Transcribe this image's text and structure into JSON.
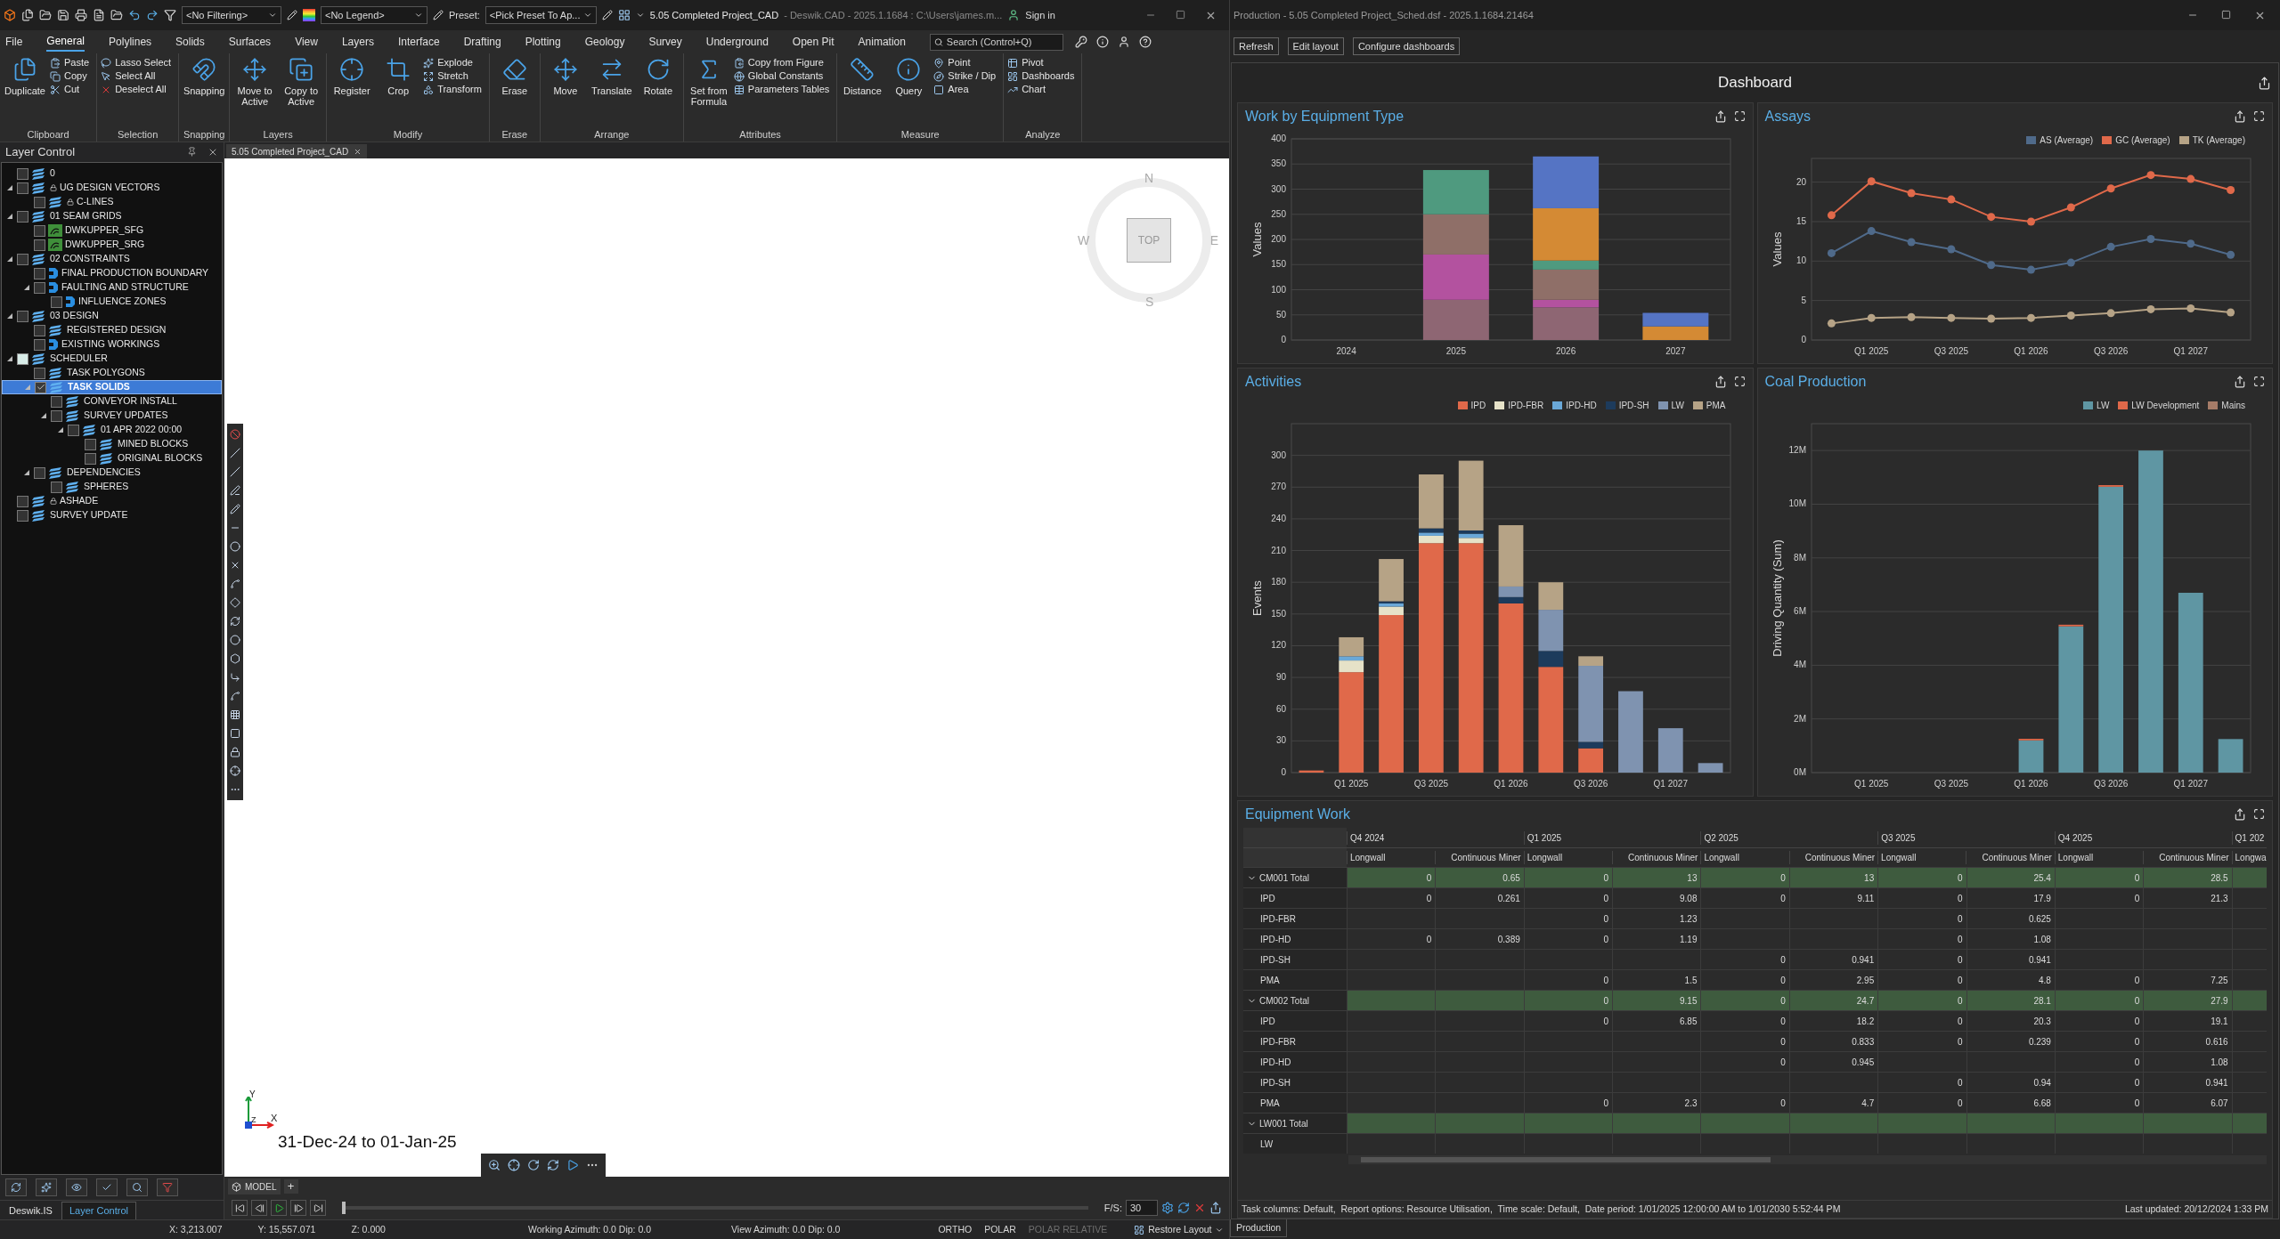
{
  "cad": {
    "title": "5.05 Completed Project_CAD",
    "title_detail": "- Deswik.CAD - 2025.1.1684 : C:\\Users\\james.m...",
    "filter": "<No Filtering>",
    "legend": "<No Legend>",
    "preset_label": "Preset:",
    "preset": "<Pick Preset To Ap...",
    "sign_in": "Sign in",
    "tabs": [
      {
        "label": "File",
        "selected": false
      },
      {
        "label": "General",
        "selected": true
      },
      {
        "label": "Polylines",
        "selected": false
      },
      {
        "label": "Solids",
        "selected": false
      },
      {
        "label": "Surfaces",
        "selected": false
      },
      {
        "label": "View",
        "selected": false
      },
      {
        "label": "Layers",
        "selected": false
      },
      {
        "label": "Interface",
        "selected": false
      },
      {
        "label": "Drafting",
        "selected": false
      },
      {
        "label": "Plotting",
        "selected": false
      },
      {
        "label": "Geology",
        "selected": false
      },
      {
        "label": "Survey",
        "selected": false
      },
      {
        "label": "Underground",
        "selected": false
      },
      {
        "label": "Open Pit",
        "selected": false
      },
      {
        "label": "Animation",
        "selected": false
      }
    ],
    "search": {
      "placeholder": "Search (Control+Q)"
    },
    "ribbon": [
      {
        "label": "Clipboard",
        "items": [
          {
            "label": "Duplicate",
            "kind": "large"
          },
          {
            "label": "Paste",
            "kind": "small"
          },
          {
            "label": "Copy",
            "kind": "small"
          },
          {
            "label": "Cut",
            "kind": "small"
          }
        ]
      },
      {
        "label": "Selection",
        "items": [
          {
            "label": "Lasso Select",
            "kind": "small"
          },
          {
            "label": "Select All",
            "kind": "small"
          },
          {
            "label": "Deselect All",
            "kind": "small"
          }
        ]
      },
      {
        "label": "Snapping",
        "items": [
          {
            "label": "Snapping",
            "kind": "large"
          }
        ]
      },
      {
        "label": "Layers",
        "items": [
          {
            "label": "Move to Active",
            "kind": "large"
          },
          {
            "label": "Copy to Active",
            "kind": "large"
          }
        ]
      },
      {
        "label": "Modify",
        "items": [
          {
            "label": "Register",
            "kind": "large"
          },
          {
            "label": "Crop",
            "kind": "large"
          },
          {
            "label": "Explode",
            "kind": "small"
          },
          {
            "label": "Stretch",
            "kind": "small"
          },
          {
            "label": "Transform",
            "kind": "small"
          }
        ]
      },
      {
        "label": "Erase",
        "items": [
          {
            "label": "Erase",
            "kind": "large"
          }
        ]
      },
      {
        "label": "Arrange",
        "items": [
          {
            "label": "Move",
            "kind": "large"
          },
          {
            "label": "Translate",
            "kind": "large"
          },
          {
            "label": "Rotate",
            "kind": "large"
          }
        ]
      },
      {
        "label": "Attributes",
        "items": [
          {
            "label": "Set from Formula",
            "kind": "large"
          },
          {
            "label": "Copy from Figure",
            "kind": "small"
          },
          {
            "label": "Global Constants",
            "kind": "small"
          },
          {
            "label": "Parameters Tables",
            "kind": "small"
          }
        ]
      },
      {
        "label": "Measure",
        "items": [
          {
            "label": "Distance",
            "kind": "large"
          },
          {
            "label": "Query",
            "kind": "large"
          },
          {
            "label": "Point",
            "kind": "small"
          },
          {
            "label": "Strike / Dip",
            "kind": "small"
          },
          {
            "label": "Area",
            "kind": "small"
          }
        ]
      },
      {
        "label": "Analyze",
        "items": [
          {
            "label": "Pivot",
            "kind": "small"
          },
          {
            "label": "Dashboards",
            "kind": "small"
          },
          {
            "label": "Chart",
            "kind": "small"
          }
        ]
      }
    ],
    "layer_panel": {
      "title": "Layer Control",
      "layers": [
        {
          "label": "0",
          "checked": false,
          "locked": false,
          "kind": "layers",
          "selected": false
        },
        {
          "label": "UG DESIGN VECTORS",
          "checked": false,
          "locked": true,
          "kind": "layers",
          "selected": false,
          "children": [
            {
              "label": "C-LINES",
              "checked": false,
              "locked": true,
              "kind": "layers",
              "selected": false
            }
          ]
        },
        {
          "label": "01 SEAM GRIDS",
          "checked": false,
          "locked": false,
          "kind": "layers",
          "selected": false,
          "children": [
            {
              "label": "DWKUPPER_SFG",
              "checked": false,
              "locked": false,
              "kind": "grid",
              "selected": false
            },
            {
              "label": "DWKUPPER_SRG",
              "checked": false,
              "locked": false,
              "kind": "grid",
              "selected": false
            }
          ]
        },
        {
          "label": "02 CONSTRAINTS",
          "checked": false,
          "locked": false,
          "kind": "layers",
          "selected": false,
          "children": [
            {
              "label": "FINAL PRODUCTION BOUNDARY",
              "checked": false,
              "locked": false,
              "kind": "boundary",
              "selected": false
            },
            {
              "label": "FAULTING AND STRUCTURE",
              "checked": false,
              "locked": false,
              "kind": "boundary",
              "selected": false,
              "children": [
                {
                  "label": "INFLUENCE ZONES",
                  "checked": false,
                  "locked": false,
                  "kind": "boundary",
                  "selected": false
                }
              ]
            }
          ]
        },
        {
          "label": "03 DESIGN",
          "checked": false,
          "locked": false,
          "kind": "layers",
          "selected": false,
          "children": [
            {
              "label": "REGISTERED DESIGN",
              "checked": false,
              "locked": false,
              "kind": "layers",
              "selected": false
            },
            {
              "label": "EXISTING WORKINGS",
              "checked": false,
              "locked": false,
              "kind": "boundary",
              "selected": false
            }
          ]
        },
        {
          "label": "SCHEDULER",
          "checked": false,
          "indeterminate": true,
          "locked": false,
          "kind": "layers",
          "selected": false,
          "children": [
            {
              "label": "TASK POLYGONS",
              "checked": false,
              "locked": false,
              "kind": "layers",
              "selected": false
            },
            {
              "label": "TASK SOLIDS",
              "checked": true,
              "locked": false,
              "kind": "layers",
              "selected": true,
              "children": [
                {
                  "label": "CONVEYOR INSTALL",
                  "checked": false,
                  "locked": false,
                  "kind": "layers",
                  "selected": false
                },
                {
                  "label": "SURVEY UPDATES",
                  "checked": false,
                  "locked": false,
                  "kind": "layers",
                  "selected": false,
                  "children": [
                    {
                      "label": "01 APR 2022 00:00",
                      "checked": false,
                      "locked": false,
                      "kind": "layers",
                      "selected": false,
                      "children": [
                        {
                          "label": "MINED BLOCKS",
                          "checked": false,
                          "locked": false,
                          "kind": "layers",
                          "selected": false
                        },
                        {
                          "label": "ORIGINAL BLOCKS",
                          "checked": false,
                          "locked": false,
                          "kind": "layers",
                          "selected": false
                        }
                      ]
                    }
                  ]
                }
              ]
            },
            {
              "label": "DEPENDENCIES",
              "checked": false,
              "locked": false,
              "kind": "layers",
              "selected": false,
              "children": [
                {
                  "label": "SPHERES",
                  "checked": false,
                  "locked": false,
                  "kind": "layers",
                  "selected": false
                }
              ]
            }
          ]
        },
        {
          "label": "ASHADE",
          "checked": false,
          "locked": true,
          "kind": "layers",
          "selected": false
        },
        {
          "label": "SURVEY UPDATE",
          "checked": false,
          "locked": false,
          "kind": "layers",
          "selected": false
        }
      ],
      "tabs": [
        {
          "label": "Deswik.IS",
          "selected": false
        },
        {
          "label": "Layer Control",
          "selected": true
        }
      ]
    },
    "document_tab": "5.05 Completed Project_CAD",
    "compass": {
      "n": "N",
      "e": "E",
      "s": "S",
      "w": "W",
      "cube": "TOP"
    },
    "axes": {
      "y": "Y",
      "x": "X",
      "z": "Z"
    },
    "date_range": "31-Dec-24 to 01-Jan-25",
    "model_tab": "MODEL",
    "add_tab": "+",
    "playback": {
      "level": 0,
      "fps_label": "F/S:",
      "fps": "30"
    },
    "status_bar": [
      {
        "text": "X: 3,213.007",
        "kind": "coord",
        "disabled": false
      },
      {
        "text": "Y: 15,557.071",
        "kind": "coord",
        "disabled": false
      },
      {
        "text": "Z: 0.000",
        "kind": "coord",
        "disabled": false
      },
      {
        "text": "Working Azimuth: 0.0 Dip: 0.0",
        "kind": "azimuth",
        "disabled": false
      },
      {
        "text": "View Azimuth: 0.0 Dip: 0.0",
        "kind": "azimuth",
        "disabled": false
      },
      {
        "text": "ORTHO",
        "kind": "toggle",
        "disabled": false
      },
      {
        "text": "POLAR",
        "kind": "toggle",
        "disabled": false
      },
      {
        "text": "POLAR RELATIVE",
        "kind": "toggle",
        "disabled": true
      }
    ],
    "restore_layout": "Restore Layout"
  },
  "production": {
    "title": "Production - 5.05 Completed Project_Sched.dsf - 2025.1.1684.21464",
    "buttons": [
      "Refresh",
      "Edit layout",
      "Configure dashboards"
    ],
    "dashboard_title": "Dashboard",
    "panels": [
      {
        "title": "Work by Equipment Type",
        "chart_data": {
          "type": "bar",
          "stacked": true,
          "grid": true,
          "ylabel": "Values",
          "categories": [
            "2024",
            "2025",
            "2026",
            "2027"
          ],
          "ylim": [
            0,
            400
          ],
          "yticks": [
            0,
            50,
            100,
            150,
            200,
            250,
            300,
            350,
            400
          ],
          "series": [
            {
              "color": "#8e6673",
              "values": [
                0,
                80,
                65,
                0
              ]
            },
            {
              "color": "#b3529f",
              "values": [
                0,
                90,
                15,
                0
              ]
            },
            {
              "color": "#8f6f68",
              "values": [
                0,
                80,
                60,
                0
              ]
            },
            {
              "color": "#4f9a7f",
              "values": [
                0,
                88,
                18,
                0
              ]
            },
            {
              "color": "#d48a34",
              "values": [
                0,
                0,
                104,
                27
              ]
            },
            {
              "color": "#5574c4",
              "values": [
                0,
                0,
                103,
                27
              ]
            }
          ]
        }
      },
      {
        "title": "Assays",
        "chart_data": {
          "type": "line",
          "grid": true,
          "legend": "top-right",
          "ylabel": "Values",
          "categories": [
            null,
            "Q1 2025",
            null,
            "Q3 2025",
            null,
            "Q1 2026",
            null,
            "Q3 2026",
            null,
            "Q1 2027",
            null
          ],
          "ylim": [
            0,
            23
          ],
          "yticks": [
            0,
            5,
            10,
            15,
            20
          ],
          "series": [
            {
              "name": "AS (Average)",
              "color": "#4f6a8a",
              "marker": "circle",
              "values": [
                11.0,
                13.8,
                12.4,
                11.5,
                9.5,
                8.9,
                9.8,
                11.8,
                12.8,
                12.2,
                10.8
              ]
            },
            {
              "name": "GC (Average)",
              "color": "#e0694a",
              "marker": "circle",
              "values": [
                15.8,
                20.1,
                18.6,
                17.8,
                15.6,
                15.0,
                16.8,
                19.2,
                20.9,
                20.4,
                19.0
              ]
            },
            {
              "name": "TK (Average)",
              "color": "#b6a386",
              "marker": "circle",
              "values": [
                2.1,
                2.8,
                2.9,
                2.8,
                2.7,
                2.8,
                3.1,
                3.4,
                3.9,
                4.0,
                3.5
              ]
            }
          ]
        }
      },
      {
        "title": "Activities",
        "chart_data": {
          "type": "bar",
          "stacked": true,
          "grid": true,
          "legend": "top-right",
          "ylabel": "Events",
          "categories": [
            null,
            "Q1 2025",
            null,
            "Q3 2025",
            null,
            "Q1 2026",
            null,
            "Q3 2026",
            null,
            "Q1 2027",
            null
          ],
          "ylim": [
            0,
            330
          ],
          "yticks": [
            0,
            30,
            60,
            90,
            120,
            150,
            180,
            210,
            240,
            270,
            300
          ],
          "series": [
            {
              "name": "IPD",
              "color": "#e0694a",
              "values": [
                2,
                95,
                149,
                217,
                217,
                160,
                100,
                23,
                0,
                0,
                0
              ]
            },
            {
              "name": "IPD-FBR",
              "color": "#e6e2c8",
              "values": [
                0,
                11,
                8,
                7,
                5,
                0,
                0,
                0,
                0,
                0,
                0
              ]
            },
            {
              "name": "IPD-HD",
              "color": "#6aa8d8",
              "values": [
                0,
                4,
                3,
                3,
                4,
                0,
                0,
                0,
                0,
                0,
                0
              ]
            },
            {
              "name": "IPD-SH",
              "color": "#1d3b5c",
              "values": [
                0,
                0,
                2,
                4,
                3,
                6,
                15,
                6,
                0,
                0,
                0
              ]
            },
            {
              "name": "LW",
              "color": "#7f93b0",
              "values": [
                0,
                0,
                0,
                0,
                0,
                10,
                39,
                72,
                77,
                42,
                9
              ]
            },
            {
              "name": "PMA",
              "color": "#b6a386",
              "values": [
                0,
                18,
                40,
                51,
                66,
                58,
                26,
                9,
                0,
                0,
                0
              ]
            }
          ]
        }
      },
      {
        "title": "Coal Production",
        "chart_data": {
          "type": "bar",
          "stacked": true,
          "grid": true,
          "legend": "top-right",
          "ylabel": "Driving Quantity (Sum)",
          "categories": [
            null,
            "Q1 2025",
            null,
            "Q3 2025",
            null,
            "Q1 2026",
            null,
            "Q3 2026",
            null,
            "Q1 2027",
            null
          ],
          "ylim": [
            0,
            13000000
          ],
          "yticks": [
            {
              "value": 0,
              "label": "0M"
            },
            {
              "value": 2000000,
              "label": "2M"
            },
            {
              "value": 4000000,
              "label": "4M"
            },
            {
              "value": 6000000,
              "label": "6M"
            },
            {
              "value": 8000000,
              "label": "8M"
            },
            {
              "value": 10000000,
              "label": "10M"
            },
            {
              "value": 12000000,
              "label": "12M"
            }
          ],
          "series": [
            {
              "name": "LW",
              "color": "#5f96a3",
              "values": [
                0,
                0,
                0,
                0,
                0,
                1200000,
                5450000,
                10650000,
                12000000,
                6700000,
                1250000
              ]
            },
            {
              "name": "LW Development",
              "color": "#e0694a",
              "values": [
                0,
                0,
                0,
                0,
                0,
                60000,
                60000,
                60000,
                0,
                0,
                0
              ]
            },
            {
              "name": "Mains",
              "color": "#a67c68",
              "values": [
                0,
                0,
                0,
                0,
                0,
                0,
                0,
                0,
                0,
                0,
                0
              ]
            }
          ]
        }
      }
    ],
    "table": {
      "title": "Equipment Work",
      "groups": [
        {
          "label": "Q4 2024",
          "columns": [
            "Longwall",
            "Continuous Miner"
          ]
        },
        {
          "label": "Q1 2025",
          "columns": [
            "Longwall",
            "Continuous Miner"
          ]
        },
        {
          "label": "Q2 2025",
          "columns": [
            "Longwall",
            "Continuous Miner"
          ]
        },
        {
          "label": "Q3 2025",
          "columns": [
            "Longwall",
            "Continuous Miner"
          ]
        },
        {
          "label": "Q4 2025",
          "columns": [
            "Longwall",
            "Continuous Miner"
          ]
        },
        {
          "label": "Q1 202",
          "columns": [
            "Longwa"
          ]
        }
      ],
      "rows": [
        {
          "label": "CM001 Total",
          "kind": "total",
          "expanded": true,
          "cells": [
            "0",
            "0.65",
            "0",
            "13",
            "0",
            "13",
            "0",
            "25.4",
            "0",
            "28.5"
          ]
        },
        {
          "label": "IPD",
          "kind": "item",
          "cells": [
            "0",
            "0.261",
            "0",
            "9.08",
            "0",
            "9.11",
            "0",
            "17.9",
            "0",
            "21.3"
          ]
        },
        {
          "label": "IPD-FBR",
          "kind": "item",
          "cells": [
            null,
            null,
            "0",
            "1.23",
            null,
            null,
            "0",
            "0.625",
            null,
            null
          ]
        },
        {
          "label": "IPD-HD",
          "kind": "item",
          "cells": [
            "0",
            "0.389",
            "0",
            "1.19",
            null,
            null,
            "0",
            "1.08",
            null,
            null
          ]
        },
        {
          "label": "IPD-SH",
          "kind": "item",
          "cells": [
            null,
            null,
            null,
            null,
            "0",
            "0.941",
            "0",
            "0.941",
            null,
            null
          ]
        },
        {
          "label": "PMA",
          "kind": "item",
          "cells": [
            null,
            null,
            "0",
            "1.5",
            "0",
            "2.95",
            "0",
            "4.8",
            "0",
            "7.25"
          ]
        },
        {
          "label": "CM002 Total",
          "kind": "total",
          "expanded": true,
          "cells": [
            null,
            null,
            "0",
            "9.15",
            "0",
            "24.7",
            "0",
            "28.1",
            "0",
            "27.9"
          ]
        },
        {
          "label": "IPD",
          "kind": "item",
          "cells": [
            null,
            null,
            "0",
            "6.85",
            "0",
            "18.2",
            "0",
            "20.3",
            "0",
            "19.1"
          ]
        },
        {
          "label": "IPD-FBR",
          "kind": "item",
          "cells": [
            null,
            null,
            null,
            null,
            "0",
            "0.833",
            "0",
            "0.239",
            "0",
            "0.616"
          ]
        },
        {
          "label": "IPD-HD",
          "kind": "item",
          "cells": [
            null,
            null,
            null,
            null,
            "0",
            "0.945",
            null,
            null,
            "0",
            "1.08"
          ]
        },
        {
          "label": "IPD-SH",
          "kind": "item",
          "cells": [
            null,
            null,
            null,
            null,
            null,
            null,
            "0",
            "0.94",
            "0",
            "0.941"
          ]
        },
        {
          "label": "PMA",
          "kind": "item",
          "cells": [
            null,
            null,
            "0",
            "2.3",
            "0",
            "4.7",
            "0",
            "6.68",
            "0",
            "6.07"
          ]
        },
        {
          "label": "LW001 Total",
          "kind": "total",
          "expanded": true,
          "cells": [
            null,
            null,
            null,
            null,
            null,
            null,
            null,
            null,
            null,
            null
          ]
        },
        {
          "label": "LW",
          "kind": "item",
          "cells": [
            null,
            null,
            null,
            null,
            null,
            null,
            null,
            null,
            null,
            null
          ]
        }
      ]
    },
    "footer_left": "Task columns: Default,  Report options: Resource Utilisation,  Time scale: Default,  Date period: 1/01/2025 12:00:00 AM to 1/01/2030 5:52:44 PM",
    "footer_right": "Last updated: 20/12/2024 1:33 PM",
    "bottom_tab": "Production"
  }
}
